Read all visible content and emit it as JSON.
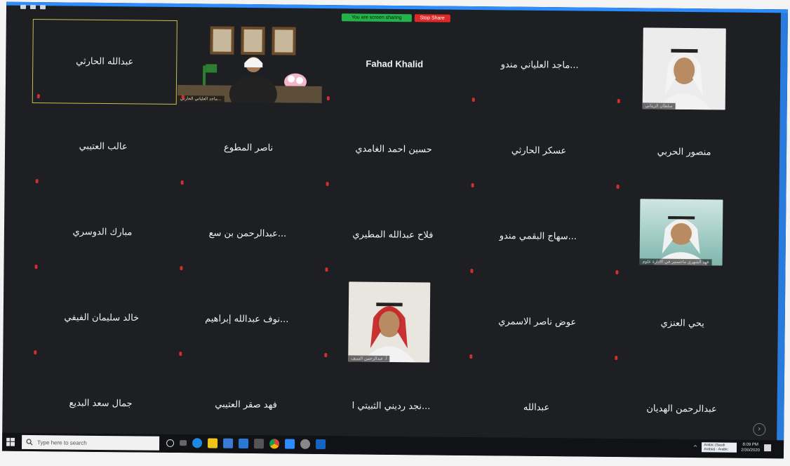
{
  "meeting": {
    "screen_sharing_label": "You are screen sharing",
    "stop_share_label": "Stop Share"
  },
  "tiles": [
    {
      "name": "عبدالله الحارثي",
      "active": true
    },
    {
      "name": "",
      "has_photo": true,
      "photo_caption": "...ماجد العلياني الحارثي",
      "photo": "office-portrait"
    },
    {
      "name": "Fahad Khalid",
      "latin": true
    },
    {
      "name": "...ماجد العلياني مندو"
    },
    {
      "name": "",
      "has_photo": true,
      "photo_caption": "سلطان الزيناني",
      "photo": "headshot-white"
    },
    {
      "name": "عالب العتيبي"
    },
    {
      "name": "ناصر المطوع"
    },
    {
      "name": "حسين احمد الغامدي"
    },
    {
      "name": "عسكر الحارثي"
    },
    {
      "name": "منصور الحربي"
    },
    {
      "name": "مبارك الدوسري"
    },
    {
      "name": "...عبدالرحمن بن سع"
    },
    {
      "name": "فلاح عبدالله المطيري"
    },
    {
      "name": "...سهاج البقمي مندو"
    },
    {
      "name": "",
      "has_photo": true,
      "photo_caption": "فهد الشهري ماجستير في الادارة علوم",
      "photo": "headshot-presenter"
    },
    {
      "name": "خالد سليمان الفيفي"
    },
    {
      "name": "...نوف عبدالله إبراهيم"
    },
    {
      "name": "",
      "has_photo": true,
      "photo_caption": "أ. عبدالرحمن السيف",
      "photo": "headshot-red"
    },
    {
      "name": "عوض ناصر الاسمري"
    },
    {
      "name": "يحي العنزي"
    },
    {
      "name": "جمال سعد البديع"
    },
    {
      "name": "فهد صقر العتيبي"
    },
    {
      "name": "...نجد رديني الثبيتي ا"
    },
    {
      "name": "عبدالله"
    },
    {
      "name": "عبدالرحمن الهديان"
    }
  ],
  "taskbar": {
    "search_placeholder": "Type here to search",
    "keyboard_line1": "Arabic (Saudi",
    "keyboard_line2": "Arabia) - Arabic",
    "time": "8:09 PM",
    "date": "2/30/2020"
  },
  "colors": {
    "zoom_blue": "#2d8cff",
    "sharing_green": "#23b34a",
    "stop_red": "#e02828",
    "active_speaker": "#c8c24a"
  },
  "icons": {
    "start": "windows-start-icon",
    "search": "search-icon",
    "cortana": "cortana-icon",
    "task_view": "task-view-icon",
    "edge": "edge-icon",
    "explorer": "file-explorer-icon",
    "store": "store-icon",
    "mail": "mail-icon",
    "calculator": "calculator-icon",
    "chrome": "chrome-icon",
    "zoom": "zoom-icon",
    "next_page": "chevron-right-icon"
  }
}
